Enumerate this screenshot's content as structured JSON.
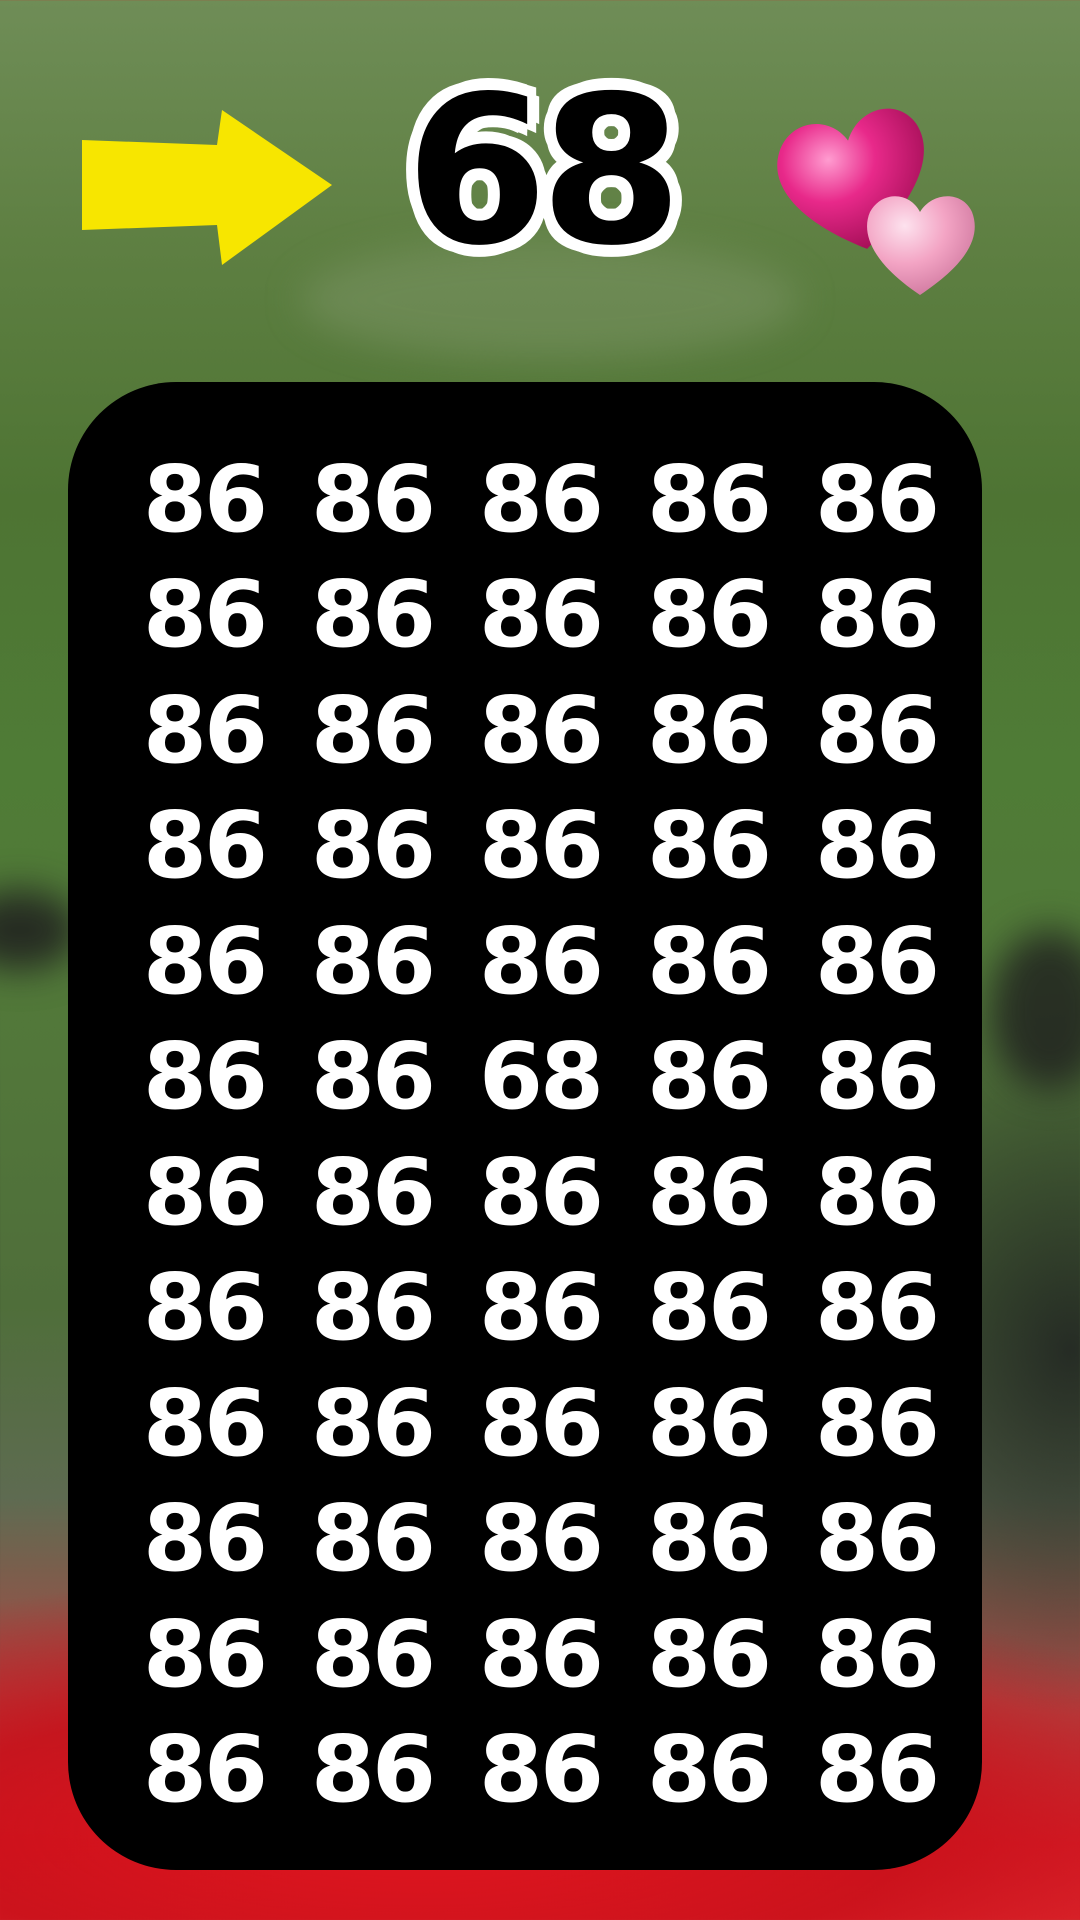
{
  "target": {
    "number": "68",
    "arrow_icon": "yellow-arrow-right-icon",
    "hearts_icon": "two-pink-hearts-icon"
  },
  "colors": {
    "arrow": "#f7e600",
    "panel": "#000000",
    "digits": "#ffffff",
    "heart_dark": "#e8298a",
    "heart_light": "#f3a4c4"
  },
  "grid": {
    "rows": [
      [
        "86",
        "86",
        "86",
        "86",
        "86"
      ],
      [
        "86",
        "86",
        "86",
        "86",
        "86"
      ],
      [
        "86",
        "86",
        "86",
        "86",
        "86"
      ],
      [
        "86",
        "86",
        "86",
        "86",
        "86"
      ],
      [
        "86",
        "86",
        "86",
        "86",
        "86"
      ],
      [
        "86",
        "86",
        "68",
        "86",
        "86"
      ],
      [
        "86",
        "86",
        "86",
        "86",
        "86"
      ],
      [
        "86",
        "86",
        "86",
        "86",
        "86"
      ],
      [
        "86",
        "86",
        "86",
        "86",
        "86"
      ],
      [
        "86",
        "86",
        "86",
        "86",
        "86"
      ],
      [
        "86",
        "86",
        "86",
        "86",
        "86"
      ],
      [
        "86",
        "86",
        "86",
        "86",
        "86"
      ]
    ]
  }
}
